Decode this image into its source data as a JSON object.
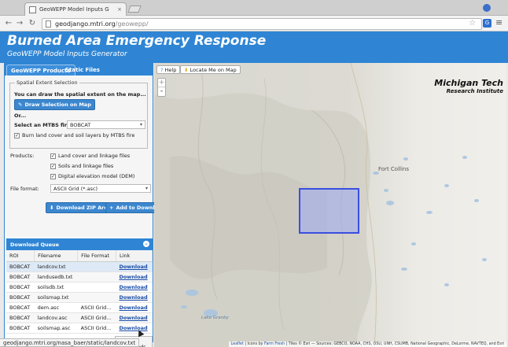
{
  "browser": {
    "tab_title": "GeoWEPP Model Inputs G",
    "tab_close": "×",
    "url_host": "geodjango.mtri.org",
    "url_path": "/geowepp/",
    "status_url": "geodjango.mtri.org/nasa_baer/static/landcov.txt"
  },
  "header": {
    "title": "Burned Area Emergency Response",
    "subtitle": "GeoWEPP Model Inputs Generator"
  },
  "tabs": [
    {
      "label": "GeoWEPP Products"
    },
    {
      "label": "Static Files"
    }
  ],
  "form": {
    "spatial_legend": "Spatial Extent Selection",
    "draw_text": "You can draw the spatial extent on the map...",
    "draw_button": "Draw Selection on Map",
    "or_text": "Or...",
    "fire_label": "Select an MTBS fire:",
    "fire_value": "BOBCAT",
    "burn_checkbox": "Burn land cover and soil layers by MTBS fire",
    "products_label": "Products:",
    "products": [
      {
        "label": "Land cover and linkage files"
      },
      {
        "label": "Soils and linkage files"
      },
      {
        "label": "Digital elevation model (DEM)"
      }
    ],
    "format_label": "File format:",
    "format_value": "ASCII Grid (*.asc)",
    "download_zip": "Download ZIP Archive",
    "add_download": "Add to Download"
  },
  "queue": {
    "title": "Download Queue",
    "columns": [
      "ROI",
      "Filename",
      "File Format",
      "Link"
    ],
    "rows": [
      [
        "BOBCAT",
        "landcov.txt",
        "",
        "Download"
      ],
      [
        "BOBCAT",
        "landusedb.txt",
        "",
        "Download"
      ],
      [
        "BOBCAT",
        "soilsdb.txt",
        "",
        "Download"
      ],
      [
        "BOBCAT",
        "soilsmap.txt",
        "",
        "Download"
      ],
      [
        "BOBCAT",
        "dem.asc",
        "ASCII Grid...",
        "Download"
      ],
      [
        "BOBCAT",
        "landcov.asc",
        "ASCII Grid...",
        "Download"
      ],
      [
        "BOBCAT",
        "soilsmap.asc",
        "ASCII Grid...",
        "Download"
      ]
    ],
    "clear_button": "Clear Downloads"
  },
  "map": {
    "help_button": "Help",
    "locate_button": "Locate Me on Map",
    "zoom_in": "+",
    "zoom_out": "-",
    "logo_line1": "Michigan Tech",
    "logo_line2": "Research Institute",
    "place_fort_collins": "Fort Collins",
    "place_lake_granby": "Lake Granby",
    "attribution_leaflet": "Leaflet",
    "attribution_mid": " | Icons by ",
    "attribution_icons": "Farm Fresh",
    "attribution_rest": " | Tiles © Esri — Sources: GEBCO, NOAA, CHS, OSU, UNH, CSUMB, National Geographic, DeLorme, NAVTEQ, and Esri"
  },
  "colors": {
    "header_blue": "#2f85d4",
    "selection_fill": "#9aaaf2",
    "selection_stroke": "#3a4fe0"
  }
}
